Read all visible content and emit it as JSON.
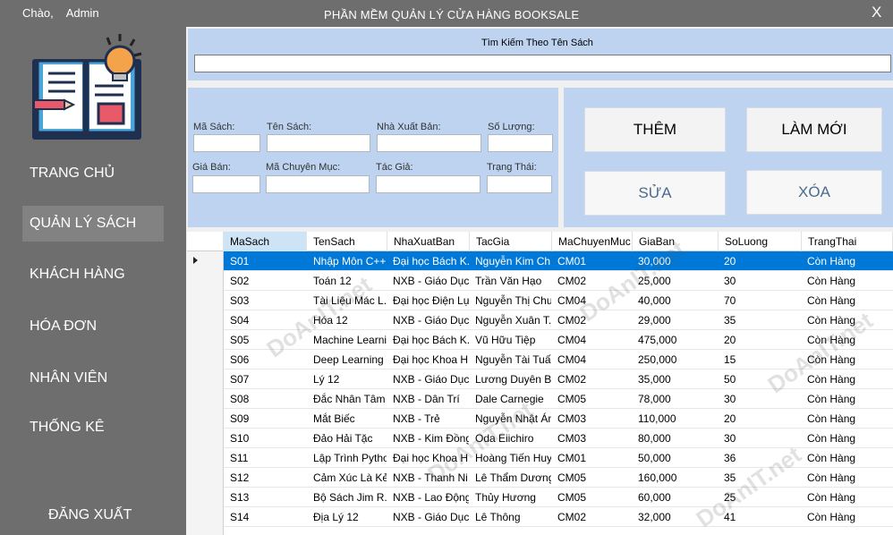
{
  "window": {
    "greeting_label": "Chào,",
    "user_name": "Admin",
    "title": "PHẦN MỀM QUẢN LÝ CỬA HÀNG BOOKSALE",
    "close_symbol": "X"
  },
  "sidebar": {
    "logo_icon": "book-lightbulb-icon",
    "items": [
      {
        "label": "TRANG CHỦ",
        "active": false
      },
      {
        "label": "QUẢN LÝ SÁCH",
        "active": true
      },
      {
        "label": "KHÁCH HÀNG",
        "active": false
      },
      {
        "label": "HÓA ĐƠN",
        "active": false
      },
      {
        "label": "NHÂN VIÊN",
        "active": false
      },
      {
        "label": "THỐNG KÊ",
        "active": false
      }
    ],
    "logout_label": "ĐĂNG  XUẤT"
  },
  "search": {
    "label": "Tìm Kiếm Theo Tên Sách",
    "value": ""
  },
  "form": {
    "ma_sach": "Mã Sách:",
    "ten_sach": "Tên Sách:",
    "nha_xuat_ban": "Nhà Xuất Bản:",
    "so_luong": "Số Lượng:",
    "gia_ban": "Giá Bán:",
    "ma_chuyen_muc": "Mã Chuyên Mục:",
    "tac_gia": "Tác Giả:",
    "trang_thai": "Trạng Thái:"
  },
  "buttons": {
    "add": "THÊM",
    "refresh": "LÀM MỚI",
    "edit": "SỬA",
    "delete": "XÓA"
  },
  "watermark_text": "DoAnIT.net",
  "grid": {
    "columns": [
      "MaSach",
      "TenSach",
      "NhaXuatBan",
      "TacGia",
      "MaChuyenMuc",
      "GiaBan",
      "SoLuong",
      "TrangThai"
    ],
    "rows": [
      [
        "S01",
        "Nhập Môn C++",
        "Đại học Bách K...",
        "Nguyễn Kim Ch...",
        "CM01",
        "30,000",
        "20",
        "Còn Hàng"
      ],
      [
        "S02",
        "Toán 12",
        "NXB - Giáo Dục",
        "Trần Văn Hạo",
        "CM02",
        "25,000",
        "30",
        "Còn Hàng"
      ],
      [
        "S03",
        "Tài Liệu Mác L...",
        "Đại học Điện Lự...",
        "Nguyễn Thị Chu...",
        "CM04",
        "40,000",
        "70",
        "Còn Hàng"
      ],
      [
        "S04",
        "Hóa 12",
        "NXB - Giáo Dục",
        "Nguyễn Xuân T...",
        "CM02",
        "29,000",
        "35",
        "Còn Hàng"
      ],
      [
        "S05",
        "Machine Learni...",
        "Đại học Bách K...",
        "Vũ Hữu Tiệp",
        "CM04",
        "475,000",
        "20",
        "Còn Hàng"
      ],
      [
        "S06",
        "Deep Learning ...",
        "Đại học Khoa H...",
        "Nguyễn Tài Tuấn",
        "CM04",
        "250,000",
        "15",
        "Còn Hàng"
      ],
      [
        "S07",
        "Lý 12",
        "NXB - Giáo Dục",
        "Lương Duyên Bì...",
        "CM02",
        "35,000",
        "50",
        "Còn Hàng"
      ],
      [
        "S08",
        "Đắc Nhân Tâm",
        "NXB - Dân Trí",
        "Dale Carnegie",
        "CM05",
        "78,000",
        "30",
        "Còn Hàng"
      ],
      [
        "S09",
        "Mắt Biếc",
        "NXB - Trẻ",
        "Nguyễn Nhật Ánh",
        "CM03",
        "110,000",
        "20",
        "Còn Hàng"
      ],
      [
        "S10",
        "Đảo Hải Tặc",
        "NXB - Kim Đồng",
        "Oda Eiichiro",
        "CM03",
        "80,000",
        "30",
        "Còn Hàng"
      ],
      [
        "S11",
        "Lập Trình Python",
        "Đại học Khoa H...",
        "Hoàng Tiến Huy",
        "CM01",
        "50,000",
        "36",
        "Còn Hàng"
      ],
      [
        "S12",
        "Cảm Xúc Là Kẻ...",
        "NXB - Thanh Ni...",
        "Lê Thẩm Dương",
        "CM05",
        "160,000",
        "35",
        "Còn Hàng"
      ],
      [
        "S13",
        "Bộ Sách Jim R...",
        "NXB - Lao Động",
        "Thủy Hương",
        "CM05",
        "60,000",
        "25",
        "Còn Hàng"
      ],
      [
        "S14",
        "Địa Lý 12",
        "NXB - Giáo Dục",
        "Lê Thông",
        "CM02",
        "32,000",
        "41",
        "Còn Hàng"
      ]
    ]
  }
}
